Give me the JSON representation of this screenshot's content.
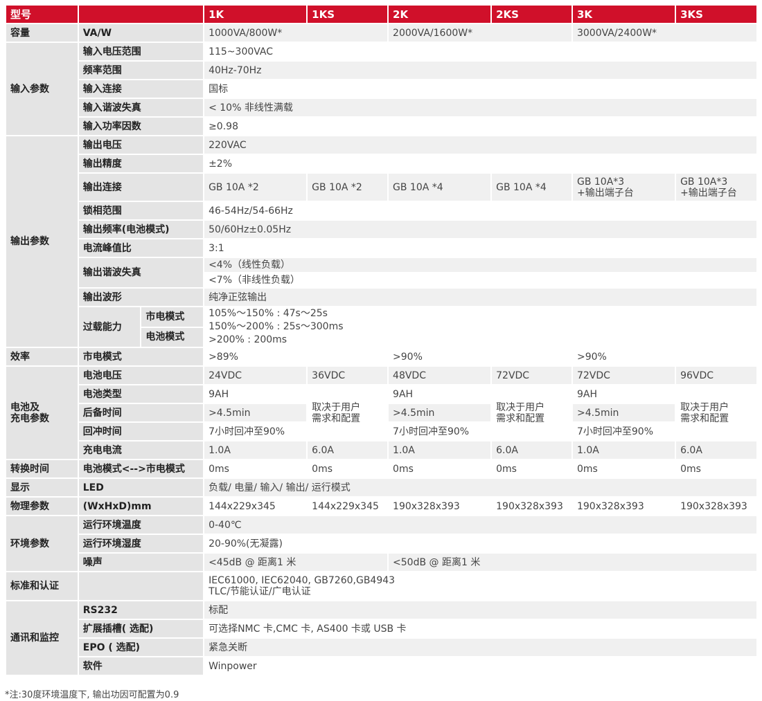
{
  "header": {
    "model": "型号",
    "c1k": "1K",
    "c1ks": "1KS",
    "c2k": "2K",
    "c2ks": "2KS",
    "c3k": "3K",
    "c3ks": "3KS"
  },
  "capacity": {
    "cat": "容量",
    "sub": "VA/W",
    "v1": "1000VA/800W*",
    "v2": "2000VA/1600W*",
    "v3": "3000VA/2400W*"
  },
  "input": {
    "cat": "输入参数",
    "voltage_range": {
      "label": "输入电压范围",
      "value": "115~300VAC"
    },
    "freq_range": {
      "label": "频率范围",
      "value": "40Hz-70Hz"
    },
    "connection": {
      "label": "输入连接",
      "value": "国标"
    },
    "thd": {
      "label": "输入谐波失真",
      "value": "< 10% 非线性满载"
    },
    "pf": {
      "label": "输入功率因数",
      "value": "≥0.98"
    }
  },
  "output": {
    "cat": "输出参数",
    "voltage": {
      "label": "输出电压",
      "value": "220VAC"
    },
    "accuracy": {
      "label": "输出精度",
      "value": "±2%"
    },
    "connection": {
      "label": "输出连接",
      "v1k": "GB 10A *2",
      "v1ks": "GB 10A *2",
      "v2k": "GB 10A *4",
      "v2ks": "GB 10A *4",
      "v3k_l1": "GB 10A*3",
      "v3k_l2": "+输出端子台",
      "v3ks_l1": "GB 10A*3",
      "v3ks_l2": "+输出端子台"
    },
    "phase_lock": {
      "label": "锁相范围",
      "value": "46-54Hz/54-66Hz"
    },
    "freq_batt": {
      "label": "输出频率(电池模式)",
      "value": "50/60Hz±0.05Hz"
    },
    "crest": {
      "label": "电流峰值比",
      "value": "3:1"
    },
    "thd": {
      "label": "输出谐波失真",
      "l1": "<4%（线性负载）",
      "l2": "<7%（非线性负载）"
    },
    "waveform": {
      "label": "输出波形",
      "value": "纯净正弦输出"
    },
    "overload": {
      "label": "过载能力",
      "mode1": "市电模式",
      "mode2": "电池模式",
      "l1": "105%〜150% : 47s〜25s",
      "l2": "150%〜200% : 25s〜300ms",
      "l3": ">200% : 200ms"
    }
  },
  "efficiency": {
    "cat": "效率",
    "sub": "市电模式",
    "v1": ">89%",
    "v2": ">90%",
    "v3": ">90%"
  },
  "battery": {
    "cat_l1": "电池及",
    "cat_l2": "充电参数",
    "voltage": {
      "label": "电池电压",
      "v1k": "24VDC",
      "v1ks": "36VDC",
      "v2k": "48VDC",
      "v2ks": "72VDC",
      "v3k": "72VDC",
      "v3ks": "96VDC"
    },
    "type": {
      "label": "电池类型",
      "v1k": "9AH",
      "v2k": "9AH",
      "v3k": "9AH"
    },
    "backup": {
      "label": "后备时间",
      "v1k": ">4.5min",
      "v2k": ">4.5min",
      "v3k": ">4.5min"
    },
    "recharge": {
      "label": "回冲时间",
      "v1k": "7小时回冲至90%",
      "v2k": "7小时回冲至90%",
      "v3k": "7小时回冲至90%"
    },
    "depends_l1": "取决于用户",
    "depends_l2": "需求和配置",
    "current": {
      "label": "充电电流",
      "v1k": "1.0A",
      "v1ks": "6.0A",
      "v2k": "1.0A",
      "v2ks": "6.0A",
      "v3k": "1.0A",
      "v3ks": "6.0A"
    }
  },
  "transfer": {
    "cat": "转换时间",
    "sub": "电池模式<-->市电模式",
    "value": "0ms"
  },
  "display": {
    "cat": "显示",
    "sub": "LED",
    "value": "负载/ 电量/ 输入/ 输出/ 运行模式"
  },
  "physical": {
    "cat": "物理参数",
    "sub": "(WxHxD)mm",
    "v1k": "144x229x345",
    "v1ks": "144x229x345",
    "v2k": "190x328x393",
    "v2ks": "190x328x393",
    "v3k": "190x328x393",
    "v3ks": "190x328x393"
  },
  "env": {
    "cat": "环境参数",
    "temp": {
      "label": "运行环境温度",
      "value": "0-40℃"
    },
    "humidity": {
      "label": "运行环境湿度",
      "value": "20-90%(无凝露)"
    },
    "noise": {
      "label": "噪声",
      "v1": "<45dB @ 距离1 米",
      "v2": "<50dB @ 距离1 米"
    }
  },
  "standards": {
    "cat": "标准和认证",
    "l1": "IEC61000, IEC62040, GB7260,GB4943",
    "l2": "TLC/节能认证/广电认证"
  },
  "comm": {
    "cat": "通讯和监控",
    "rs232": {
      "label": "RS232",
      "value": "标配"
    },
    "slot": {
      "label": "扩展插槽( 选配)",
      "value": "可选择NMC 卡,CMC 卡, AS400 卡或 USB 卡"
    },
    "epo": {
      "label": "EPO ( 选配)",
      "value": "紧急关断"
    },
    "software": {
      "label": "软件",
      "value": "Winpower"
    }
  },
  "footnote": "*注:30度环境温度下, 输出功因可配置为0.9"
}
